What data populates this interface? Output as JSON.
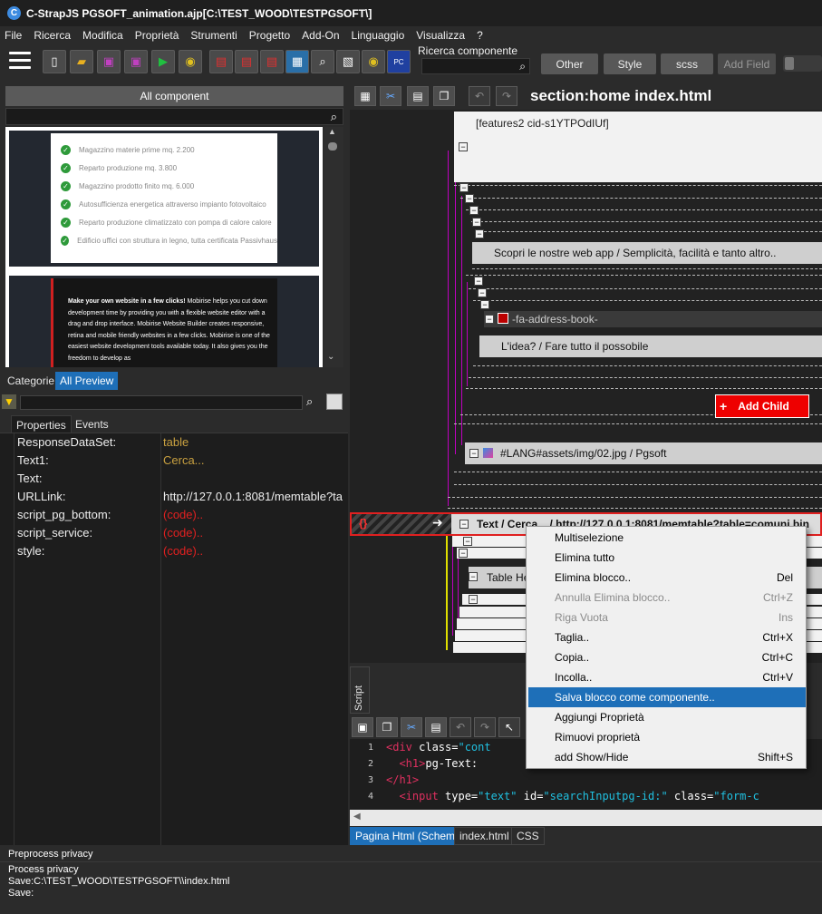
{
  "window": {
    "title": "C-StrapJS PGSOFT_animation.ajp[C:\\TEST_WOOD\\TESTPGSOFT\\]"
  },
  "menu": [
    "File",
    "Ricerca",
    "Modifica",
    "Proprietà",
    "Strumenti",
    "Progetto",
    "Add-On",
    "Linguaggio",
    "Visualizza",
    "?"
  ],
  "toolbar": {
    "component_search_label": "Ricerca componente",
    "buttons": {
      "other": "Other",
      "style": "Style",
      "scss": "scss",
      "add_field": "Add Field"
    }
  },
  "left": {
    "all_component": "All component",
    "preview1_items": [
      "Magazzino materie prime mq. 2.200",
      "Reparto produzione mq. 3.800",
      "Magazzino prodotto finito mq. 6.000",
      "Autosufficienza energetica attraverso impianto fotovoltaico",
      "Reparto produzione climatizzato con pompa di calore calore",
      "Edificio uffici con struttura in legno, tutta certificata Passivhaus"
    ],
    "preview2_bold": "Make your own website in a few clicks!",
    "preview2_text": " Mobirise helps you cut down development time by providing you with a flexible website editor with a drag and drop interface. Mobirise Website Builder creates responsive, retina and mobile friendly websites in a few clicks. Mobirise is one of the easiest website development tools available today. It also gives you the freedom to develop as",
    "tabs": {
      "categorie": "Categorie",
      "all_preview": "All Preview"
    },
    "prop_tabs": {
      "properties": "Properties",
      "events": "Events"
    },
    "properties": [
      {
        "key": "ResponseDataSet:",
        "value": "table",
        "color": "#c8a040"
      },
      {
        "key": "Text1:",
        "value": "Cerca...",
        "color": "#c8a040"
      },
      {
        "key": "Text:",
        "value": "",
        "color": "#eeeeee"
      },
      {
        "key": "URLLink:",
        "value": "http://127.0.0.1:8081/memtable?ta",
        "color": "#eeeeee"
      },
      {
        "key": "script_pg_bottom:",
        "value": "(code)..",
        "color": "#e02020"
      },
      {
        "key": "script_service:",
        "value": "(code)..",
        "color": "#e02020"
      },
      {
        "key": "style:",
        "value": "(code)..",
        "color": "#e02020"
      }
    ]
  },
  "right": {
    "section_title": "section:home index.html",
    "features_label": "[features2 cid-s1YTPOdIUf]",
    "block_scopri": "Scopri le nostre web app / Semplicità, facilità e tanto altro..",
    "block_address": "-fa-address-book-",
    "block_idea": "L'idea? / Fare tutto il possobile",
    "add_child": "Add Child",
    "block_img": "#LANG#assets/img/02.jpg / Pgsoft",
    "selected_row": "Text / Cerca... / http://127.0.0.1:8081/memtable?table=comuni.bin",
    "table_he": "Table He",
    "script_tab": "Script",
    "code_lines": [
      {
        "n": "1",
        "tag": "<div",
        "attr": " class=",
        "str": "\"cont"
      },
      {
        "n": "2",
        "tag": "  <h1>",
        "attr": "",
        "str": "",
        "text": "pg-Text:"
      },
      {
        "n": "3",
        "tag": "</h1>",
        "attr": "",
        "str": ""
      },
      {
        "n": "4",
        "tag": "  <input",
        "attr": " type=",
        "str": "\"text\"",
        "attr2": " id=",
        "str2": "\"searchInputpg-id:\"",
        "attr3": " class=",
        "str3": "\"form-c"
      }
    ],
    "bottom_tabs": [
      "Pagina Html (Schema)",
      "index.html",
      "CSS"
    ]
  },
  "context_menu": [
    {
      "label": "Multiselezione",
      "shortcut": "",
      "state": "normal",
      "u": "M"
    },
    {
      "label": "Elimina tutto",
      "shortcut": "",
      "state": "normal",
      "u": "E"
    },
    {
      "label": "Elimina blocco..",
      "shortcut": "Del",
      "state": "normal"
    },
    {
      "label": "Annulla Elimina blocco..",
      "shortcut": "Ctrl+Z",
      "state": "disabled"
    },
    {
      "label": "Riga Vuota",
      "shortcut": "Ins",
      "state": "disabled"
    },
    {
      "label": "Taglia..",
      "shortcut": "Ctrl+X",
      "state": "normal"
    },
    {
      "label": "Copia..",
      "shortcut": "Ctrl+C",
      "state": "normal"
    },
    {
      "label": "Incolla..",
      "shortcut": "Ctrl+V",
      "state": "normal"
    },
    {
      "label": "Salva blocco come componente..",
      "shortcut": "",
      "state": "highlighted"
    },
    {
      "label": "Aggiungi Proprietà",
      "shortcut": "",
      "state": "normal"
    },
    {
      "label": "Rimuovi proprietà",
      "shortcut": "",
      "state": "normal"
    },
    {
      "label": "add Show/Hide",
      "shortcut": "Shift+S",
      "state": "normal"
    }
  ],
  "status": {
    "line1": "Preprocess privacy",
    "line2": "Process privacy",
    "line3": "Save:C:\\TEST_WOOD\\TESTPGSOFT\\\\index.html",
    "line4": "Save:"
  }
}
